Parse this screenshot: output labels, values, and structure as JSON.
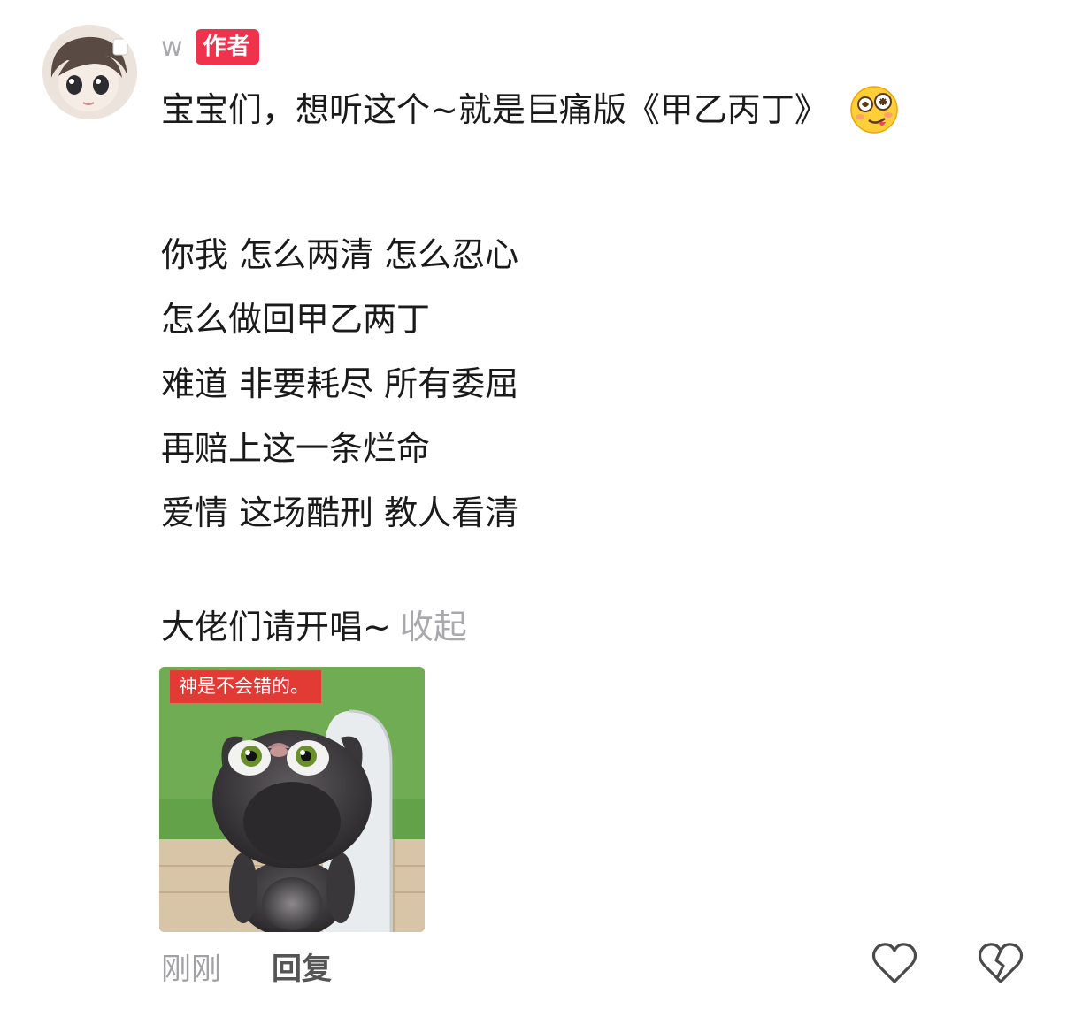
{
  "comment": {
    "username": "w",
    "author_badge": "作者",
    "headline": "宝宝们，想听这个~就是巨痛版《甲乙丙丁》",
    "headline_emoji": "woozy-face-emoji",
    "lyrics": [
      "你我 怎么两清 怎么忍心",
      "怎么做回甲乙两丁",
      "难道 非要耗尽 所有委屈",
      "再赔上这一条烂命",
      "爱情 这场酷刑 教人看清"
    ],
    "footer_text": "大佬们请开唱~",
    "collapse_label": "收起",
    "sticker": {
      "caption": "神是不会错的。",
      "description_icon": "talking-tom-cat-sticker"
    },
    "time": "刚刚",
    "reply_label": "回复",
    "icons": {
      "like": "heart-outline-icon",
      "dislike": "broken-heart-icon"
    }
  },
  "colors": {
    "badge": "#f0334d",
    "muted": "#a9a9ad",
    "text": "#1a1a1a",
    "caption_bg": "#e23a34"
  }
}
